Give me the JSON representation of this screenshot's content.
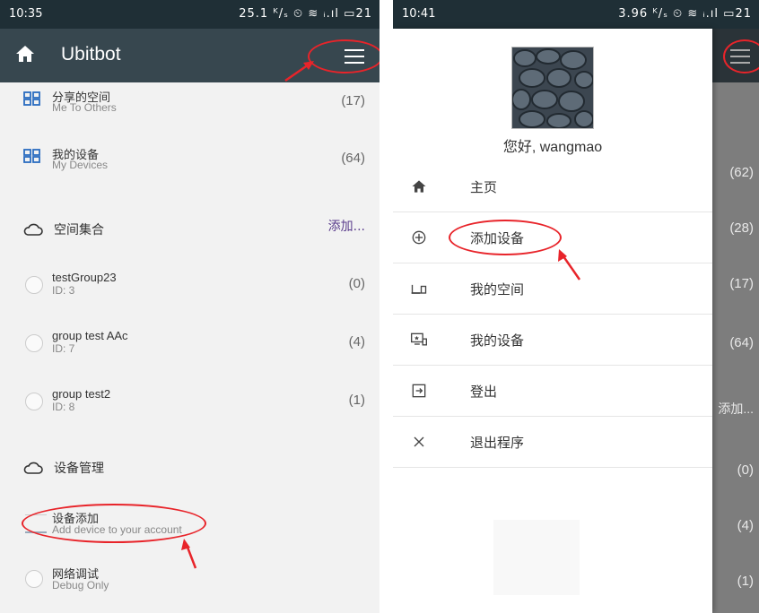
{
  "left": {
    "status": {
      "time": "10:35",
      "icons": "25.1 ᴷ/ₛ ⏲ ≋ ᵢ.ıl ▭21"
    },
    "appbar": {
      "title": "Ubitbot"
    },
    "rows": [
      {
        "label": "分享的空间",
        "sub": "Me To Others",
        "count": "(17)"
      },
      {
        "label": "我的设备",
        "sub": "My Devices",
        "count": "(64)"
      }
    ],
    "section1": {
      "label": "空间集合",
      "add": "添加..."
    },
    "groups": [
      {
        "label": "testGroup23",
        "sub": "ID: 3",
        "count": "(0)"
      },
      {
        "label": "group test AAc",
        "sub": "ID: 7",
        "count": "(4)"
      },
      {
        "label": "group test2",
        "sub": "ID: 8",
        "count": "(1)"
      }
    ],
    "section2": {
      "label": "设备管理"
    },
    "manage": [
      {
        "label": "设备添加",
        "sub": "Add device to your account"
      },
      {
        "label": "网络调试",
        "sub": "Debug Only"
      }
    ]
  },
  "right": {
    "status": {
      "time": "10:41",
      "icons": "3.96 ᴷ/ₛ ⏲ ≋ ᵢ.ıl ▭21"
    },
    "greeting": "您好, wangmao",
    "menu": [
      {
        "label": "主页",
        "icon": "home-icon"
      },
      {
        "label": "添加设备",
        "icon": "add-circle-icon"
      },
      {
        "label": "我的空间",
        "icon": "devices-icon"
      },
      {
        "label": "我的设备",
        "icon": "monitor-icon"
      },
      {
        "label": "登出",
        "icon": "logout-icon"
      },
      {
        "label": "退出程序",
        "icon": "close-icon"
      }
    ],
    "behind": {
      "counts": [
        "(62)",
        "(28)",
        "(17)",
        "(64)",
        "(0)",
        "(4)",
        "(1)"
      ],
      "add": "添加..."
    }
  },
  "colors": {
    "appbar": "#37474f",
    "statusbar": "#1f2f36",
    "annotation": "#e8242a",
    "accent": "#5a3c8c"
  }
}
